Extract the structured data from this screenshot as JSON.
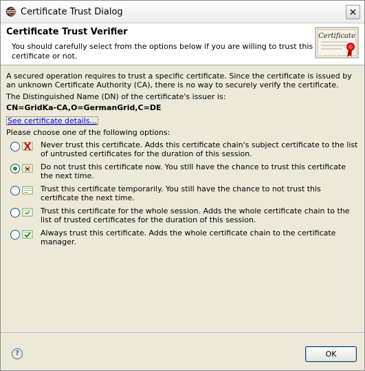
{
  "window": {
    "title": "Certificate Trust Dialog"
  },
  "banner": {
    "title": "Certificate Trust Verifier",
    "message": "You should carefully select from the options below if you are willing to trust this certificate or not.",
    "certificate_image_text": "Certificate"
  },
  "body": {
    "intro": "A secured operation requires to trust a specific certificate. Since the certificate is issued by an unknown Certificate Authority (CA), there is no way to securely verify the certificate.",
    "dn_label": "The Distinguished Name (DN) of the certificate's issuer is:",
    "dn_value": "CN=GridKa-CA,O=GermanGrid,C=DE",
    "details_link": "See certificate details...",
    "choose_label": "Please choose one of the following options:"
  },
  "options": [
    {
      "text": "Never trust this certificate. Adds this certificate chain's subject certificate to the list of untrusted certificates for the duration of this session.",
      "selected": false,
      "icon": "never-trust-icon"
    },
    {
      "text": "Do not trust this certificate now. You still have the chance to trust this certificate the next time.",
      "selected": true,
      "icon": "not-now-icon"
    },
    {
      "text": "Trust this certificate temporarily. You still have the chance to not trust this certificate the next time.",
      "selected": false,
      "icon": "trust-temporarily-icon"
    },
    {
      "text": "Trust this certificate for the whole session. Adds the whole certificate chain to the list of trusted certificates for the duration of this session.",
      "selected": false,
      "icon": "trust-session-icon"
    },
    {
      "text": "Always trust this certificate. Adds the whole certificate chain to the certificate manager.",
      "selected": false,
      "icon": "always-trust-icon"
    }
  ],
  "footer": {
    "help_symbol": "?",
    "ok_label": "OK"
  }
}
